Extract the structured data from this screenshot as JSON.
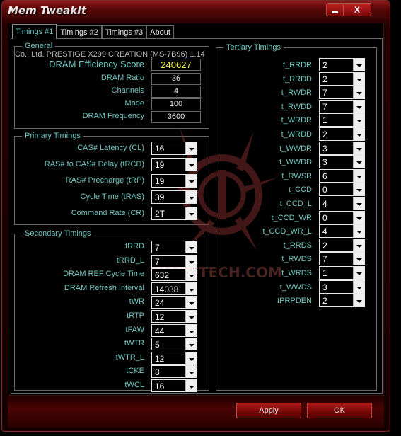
{
  "window": {
    "title": "Mem TweakIt",
    "minimize_icon": "minimize-icon",
    "close_label": "X"
  },
  "tabs": [
    {
      "label": "Timings #1",
      "active": true
    },
    {
      "label": "Timings #2",
      "active": false
    },
    {
      "label": "Timings #3",
      "active": false
    },
    {
      "label": "About",
      "active": false
    }
  ],
  "general": {
    "legend": "General",
    "motherboard": "Co., Ltd. PRESTIGE X299 CREATION (MS-7B96) 1.14",
    "rows": [
      {
        "label": "DRAM Efficiency Score",
        "value": "240627"
      },
      {
        "label": "DRAM Ratio",
        "value": "36"
      },
      {
        "label": "Channels",
        "value": "4"
      },
      {
        "label": "Mode",
        "value": "100"
      },
      {
        "label": "DRAM Frequency",
        "value": "3600"
      }
    ]
  },
  "primary": {
    "legend": "Primary Timings",
    "rows": [
      {
        "label": "CAS# Latency (CL)",
        "value": "16"
      },
      {
        "label": "RAS# to CAS# Delay (tRCD)",
        "value": "19"
      },
      {
        "label": "RAS# Precharge (tRP)",
        "value": "19"
      },
      {
        "label": "Cycle Time (tRAS)",
        "value": "39"
      },
      {
        "label": "Command Rate (CR)",
        "value": "2T"
      }
    ]
  },
  "secondary": {
    "legend": "Secondary Timings",
    "rows": [
      {
        "label": "tRRD",
        "value": "7"
      },
      {
        "label": "tRRD_L",
        "value": "7"
      },
      {
        "label": "DRAM REF Cycle Time",
        "value": "632"
      },
      {
        "label": "DRAM Refresh Interval",
        "value": "14038"
      },
      {
        "label": "tWR",
        "value": "24"
      },
      {
        "label": "tRTP",
        "value": "12"
      },
      {
        "label": "tFAW",
        "value": "44"
      },
      {
        "label": "tWTR",
        "value": "5"
      },
      {
        "label": "tWTR_L",
        "value": "12"
      },
      {
        "label": "tCKE",
        "value": "8"
      },
      {
        "label": "tWCL",
        "value": "16"
      }
    ]
  },
  "tertiary": {
    "legend": "Tertiary Timings",
    "rows": [
      {
        "label": "t_RRDR",
        "value": "2"
      },
      {
        "label": "t_RRDD",
        "value": "2"
      },
      {
        "label": "t_RWDR",
        "value": "7"
      },
      {
        "label": "t_RWDD",
        "value": "7"
      },
      {
        "label": "t_WRDR",
        "value": "1"
      },
      {
        "label": "t_WRDD",
        "value": "2"
      },
      {
        "label": "t_WWDR",
        "value": "3"
      },
      {
        "label": "t_WWDD",
        "value": "3"
      },
      {
        "label": "t_RWSR",
        "value": "6"
      },
      {
        "label": "t_CCD",
        "value": "0"
      },
      {
        "label": "t_CCD_L",
        "value": "4"
      },
      {
        "label": "t_CCD_WR",
        "value": "0"
      },
      {
        "label": "t_CCD_WR_L",
        "value": "4"
      },
      {
        "label": "t_RRDS",
        "value": "2"
      },
      {
        "label": "t_RWDS",
        "value": "7"
      },
      {
        "label": "t_WRDS",
        "value": "1"
      },
      {
        "label": "t_WWDS",
        "value": "3"
      },
      {
        "label": "tPRPDEN",
        "value": "2"
      }
    ]
  },
  "buttons": {
    "apply": "Apply",
    "ok": "OK"
  },
  "watermark": {
    "text": "VMODTECH.COM"
  },
  "colors": {
    "label": "#6fc7c0",
    "score": "#f0f040",
    "frame_red": "#7a0808"
  }
}
